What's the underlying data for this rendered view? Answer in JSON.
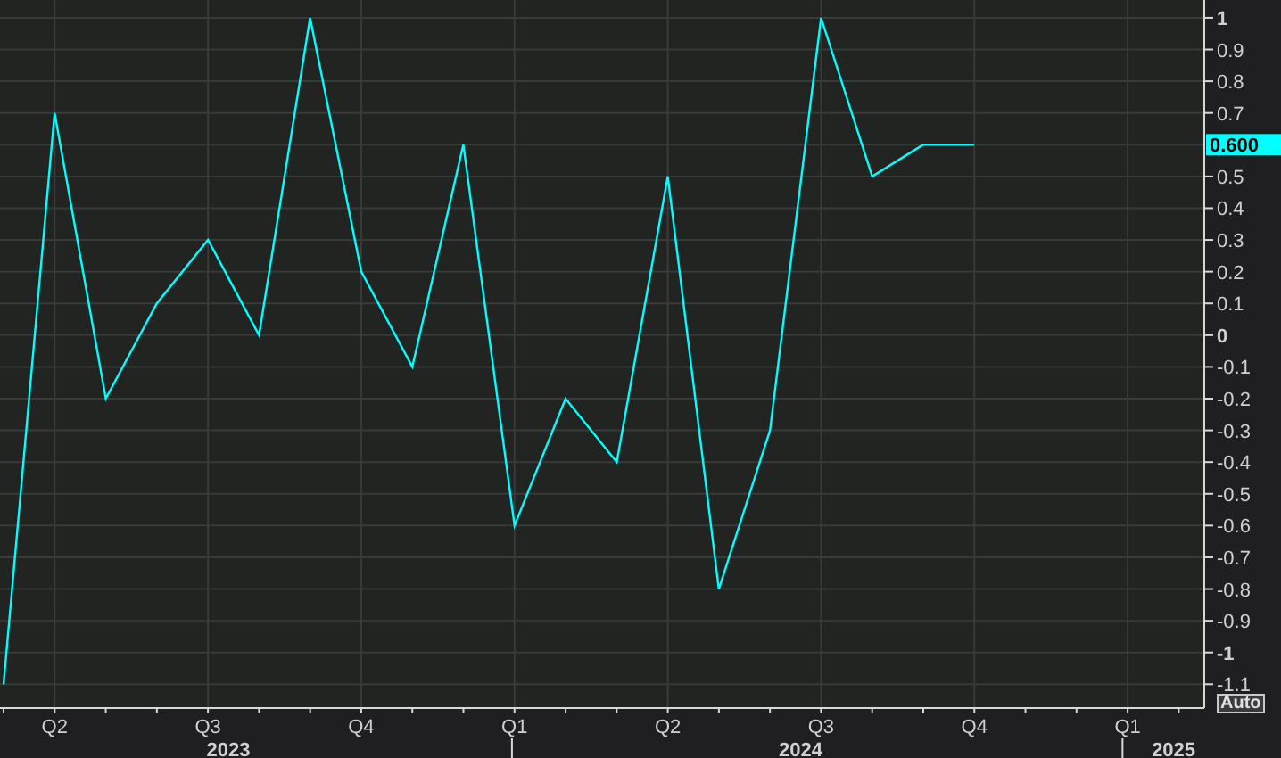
{
  "chart": {
    "chart_data": {
      "type": "line",
      "categories": [
        null,
        "Q2",
        null,
        null,
        "Q3",
        null,
        null,
        "Q4",
        null,
        null,
        "Q1",
        null,
        null,
        "Q2",
        null,
        null,
        "Q3",
        null,
        null,
        "Q4",
        null,
        null,
        "Q1",
        null
      ],
      "series": [
        {
          "color": "#00ffff",
          "values": [
            -1.1,
            0.7,
            -0.2,
            0.1,
            0.3,
            0,
            1,
            0.2,
            -0.1,
            0.6,
            -0.6,
            -0.2,
            -0.4,
            0.5,
            -0.8,
            -0.3,
            1,
            0.5,
            0.6,
            0.6,
            null,
            null,
            null,
            null
          ]
        }
      ],
      "ylim": [
        -1.175,
        1.056
      ],
      "grid": true,
      "yticks": [
        1,
        0.9,
        0.8,
        0.7,
        0.5,
        0.4,
        0.3,
        0.2,
        0.1,
        0,
        -0.1,
        -0.2,
        -0.3,
        -0.4,
        -0.5,
        -0.6,
        -0.7,
        -0.8,
        -0.9,
        -1,
        -1.1
      ]
    },
    "last_value_label": "0.600",
    "years": [
      {
        "label": "2023"
      },
      {
        "label": "2024"
      },
      {
        "label": "2025"
      }
    ],
    "auto_button": "Auto"
  }
}
